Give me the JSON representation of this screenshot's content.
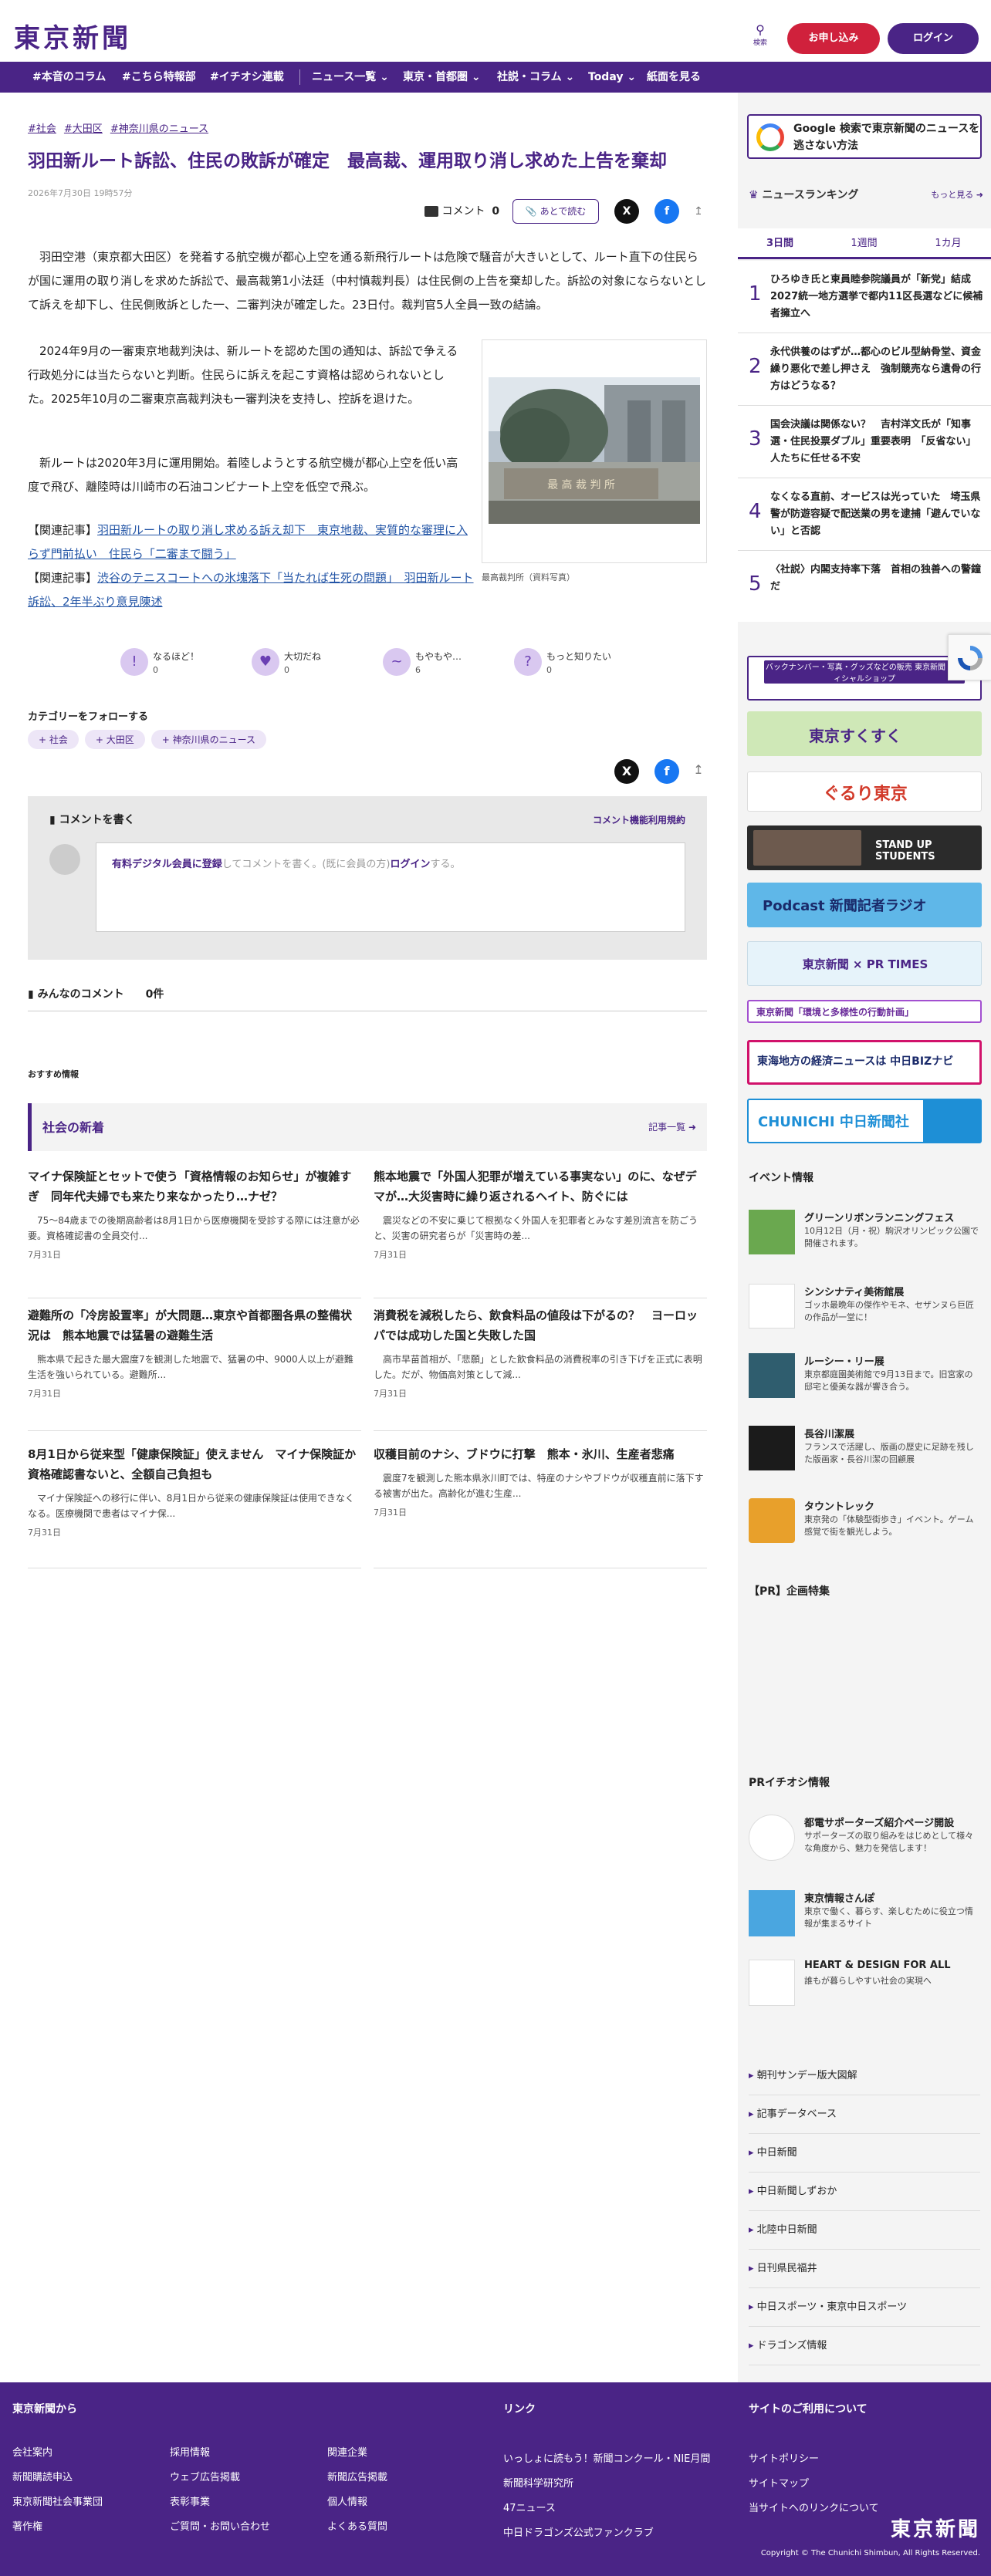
{
  "header": {
    "logo": "東京新聞",
    "search_label": "検索",
    "signup": "お申し込み",
    "login": "ログイン"
  },
  "nav": [
    "#本音のコラム",
    "#こちら特報部",
    "#イチオシ連載",
    "ニュース一覧 ⌄",
    "東京・首都圏 ⌄",
    "社説・コラム ⌄",
    "Today ⌄",
    "紙面を見る"
  ],
  "article": {
    "tags": [
      "#社会",
      "#大田区",
      "#神奈川県のニュース"
    ],
    "title": "羽田新ルート訴訟、住民の敗訴が確定　最高裁、運用取り消し求めた上告を棄却",
    "date": "2026年7月30日 19時57分",
    "comment_label": "コメント",
    "comment_count": "0",
    "read_later": "あとで読む",
    "lead": "羽田空港（東京都大田区）を発着する航空機が都心上空を通る新飛行ルートは危険で騒音が大きいとして、ルート直下の住民らが国に運用の取り消しを求めた訴訟で、最高裁第1小法廷（中村慎裁判長）は住民側の上告を棄却した。訴訟の対象にならないとして訴えを却下し、住民側敗訴とした一、二審判決が確定した。23日付。裁判官5人全員一致の結論。",
    "body2": "2024年9月の一審東京地裁判決は、新ルートを認めた国の通知は、訴訟で争える行政処分には当たらないと判断。住民らに訴えを起こす資格は認められないとした。2025年10月の二審東京高裁判決も一審判決を支持し、控訴を退けた。",
    "body3": "新ルートは2020年3月に運用開始。着陸しようとする航空機が都心上空を低い高度で飛び、離陸時は川崎市の石油コンビナート上空を低空で飛ぶ。",
    "related": [
      {
        "prefix": "【関連記事】",
        "text": "羽田新ルートの取り消し求める訴え却下　東京地裁、実質的な審理に入らず門前払い　住民ら「二審まで闘う」"
      },
      {
        "prefix": "【関連記事】",
        "text": "渋谷のテニスコートへの氷塊落下「当たれば生死の問題」　羽田新ルート訴訟、2年半ぶり意見陳述"
      }
    ],
    "photo_sign": "最 高 裁 判 所",
    "caption": "最高裁判所（資料写真）"
  },
  "reactions": [
    {
      "label": "なるほど！",
      "count": "0",
      "icon": "!"
    },
    {
      "label": "大切だね",
      "count": "0",
      "icon": "♥"
    },
    {
      "label": "もやもや…",
      "count": "6",
      "icon": "~"
    },
    {
      "label": "もっと知りたい",
      "count": "0",
      "icon": "?"
    }
  ],
  "follow": {
    "title": "カテゴリーをフォローする",
    "tags": [
      "+ 社会",
      "+ 大田区",
      "+ 神奈川県のニュース"
    ]
  },
  "comment_box": {
    "title": "コメントを書く",
    "rules": "コメント機能利用規約",
    "register": "有料デジタル会員に登録",
    "prompt": "してコメントを書く。(既に会員の方)",
    "login": "ログイン",
    "suffix": "する。"
  },
  "comments_heading": "みんなのコメント　　0件",
  "recommend_label": "おすすめ情報",
  "recommend": {
    "section": "社会の新着",
    "more": "記事一覧",
    "cards": [
      {
        "title": "マイナ保険証とセットで使う「資格情報のお知らせ」が複雑すぎ　同年代夫婦でも来たり来なかったり…ナゼ？",
        "lead": "75〜84歳までの後期高齢者は8月1日から医療機関を受診する際には注意が必要。資格確認書の全員交付...",
        "date": "7月31日"
      },
      {
        "title": "熊本地震で「外国人犯罪が増えている事実ない」のに、なぜデマが…大災害時に繰り返されるヘイト、防ぐには",
        "lead": "震災などの不安に乗じて根拠なく外国人を犯罪者とみなす差別流言を防ごうと、災害の研究者らが「災害時の差...",
        "date": "7月31日"
      },
      {
        "title": "避難所の「冷房設置率」が大問題…東京や首都圏各県の整備状況は　熊本地震では猛暑の避難生活",
        "lead": "熊本県で起きた最大震度7を観測した地震で、猛暑の中、9000人以上が避難生活を強いられている。避難所...",
        "date": "7月31日"
      },
      {
        "title": "消費税を減税したら、飲食料品の値段は下がるの？　ヨーロッパでは成功した国と失敗した国",
        "lead": "高市早苗首相が、「悲願」とした飲食料品の消費税率の引き下げを正式に表明した。だが、物価高対策として減...",
        "date": "7月31日"
      },
      {
        "title": "8月1日から従来型「健康保険証」使えません　マイナ保険証か資格確認書ないと、全額自己負担も",
        "lead": "マイナ保険証への移行に伴い、8月1日から従来の健康保険証は使用できなくなる。医療機関で患者はマイナ保...",
        "date": "7月31日"
      },
      {
        "title": "収穫目前のナシ、ブドウに打撃　熊本・氷川、生産者悲痛",
        "lead": "震度7を観測した熊本県氷川町では、特産のナシやブドウが収穫直前に落下する被害が出た。高齢化が進む生産...",
        "date": "7月31日"
      }
    ]
  },
  "sidebar": {
    "google_banner": "Google 検索で東京新聞のニュースを逃さない方法",
    "ranking_title": "ニュースランキング",
    "ranking_more": "もっと見る",
    "tabs": [
      "3日間",
      "1週間",
      "1カ月"
    ],
    "ranking": [
      {
        "n": "1",
        "text": "ひろゆき氏と東員睦参院議員が「新党」結成　2027統一地方選挙で都内11区長選などに候補者擁立へ"
      },
      {
        "n": "2",
        "text": "永代供養のはずが…都心のビル型納骨堂、資金繰り悪化で差し押さえ　強制競売なら遺骨の行方はどうなる？"
      },
      {
        "n": "3",
        "text": "国会決議は関係ない？　吉村洋文氏が「知事選・住民投票ダブル」重要表明　「反省ない」人たちに任せる不安"
      },
      {
        "n": "4",
        "text": "なくなる直前、オービスは光っていた　埼玉県警が防遊容疑で配送業の男を逮捕「避んでいない」と否認"
      },
      {
        "n": "5",
        "text": "〈社説〉内閣支持率下落　首相の独善への警鐘だ"
      }
    ],
    "banners": [
      "バックナンバー・写真・グッズなどの販売 東京新聞 オフィシャルショップ",
      "東京すくすく",
      "ぐるり東京",
      "STAND UP STUDENTS",
      "Podcast 新聞記者ラジオ",
      "東京新聞 × PR TIMES",
      "東京新聞「環境と多様性の行動計画」",
      "東海地方の経済ニュースは 中日BIZナビ",
      "CHUNICHI 中日新聞社"
    ],
    "events_title": "イベント情報",
    "events": [
      {
        "title": "グリーンリボンランニングフェス",
        "desc": "10月12日（月・祝）駒沢オリンピック公園で開催されます。"
      },
      {
        "title": "シンシナティ美術館展",
        "desc": "ゴッホ最晩年の傑作やモネ、セザンヌら巨匠の作品が一堂に！"
      },
      {
        "title": "ルーシー・リー展",
        "desc": "東京都庭園美術館で9月13日まで。旧宮家の邸宅と優美な器が響き合う。"
      },
      {
        "title": "長谷川潔展",
        "desc": "フランスで活躍し、版画の歴史に足跡を残した版画家・長谷川潔の回顧展"
      },
      {
        "title": "タウントレック",
        "desc": "東京発の「体験型街歩き」イベント。ゲーム感覚で街を観光しよう。"
      }
    ],
    "pr_title": "【PR】企画特集",
    "pr_ichi_title": "PRイチオシ情報",
    "pr": [
      {
        "title": "都電サポーターズ紹介ページ開設",
        "desc": "サポーターズの取り組みをはじめとして様々な角度から、魅力を発信します！"
      },
      {
        "title": "東京情報さんぽ",
        "desc": "東京で働く、暮らす、楽しむために役立つ情報が集まるサイト"
      },
      {
        "title": "HEART & DESIGN FOR ALL",
        "desc": "誰もが暮らしやすい社会の実現へ"
      }
    ],
    "links": [
      "朝刊サンデー版大図解",
      "記事データベース",
      "中日新聞",
      "中日新聞しずおか",
      "北陸中日新聞",
      "日刊県民福井",
      "中日スポーツ・東京中日スポーツ",
      "ドラゴンズ情報"
    ]
  },
  "footer": {
    "col1_title": "東京新聞から",
    "col1": [
      "会社案内",
      "新聞購読申込",
      "東京新聞社会事業団",
      "著作権"
    ],
    "col2": [
      "採用情報",
      "ウェブ広告掲載",
      "表彰事業",
      "ご質問・お問い合わせ"
    ],
    "col3": [
      "関連企業",
      "新聞広告掲載",
      "個人情報",
      "よくある質問"
    ],
    "col4_title": "リンク",
    "col4": [
      "いっしょに読もう！新聞コンクール・NIE月間",
      "新聞科学研究所",
      "47ニュース",
      "中日ドラゴンズ公式ファンクラブ"
    ],
    "col5_title": "サイトのご利用について",
    "col5": [
      "サイトポリシー",
      "サイトマップ",
      "当サイトへのリンクについて"
    ],
    "logo": "東京新聞",
    "copyright": "Copyright © The Chunichi Shimbun, All Rights Reserved."
  },
  "colors": {
    "brand": "#4a2486",
    "red": "#d0213c"
  }
}
